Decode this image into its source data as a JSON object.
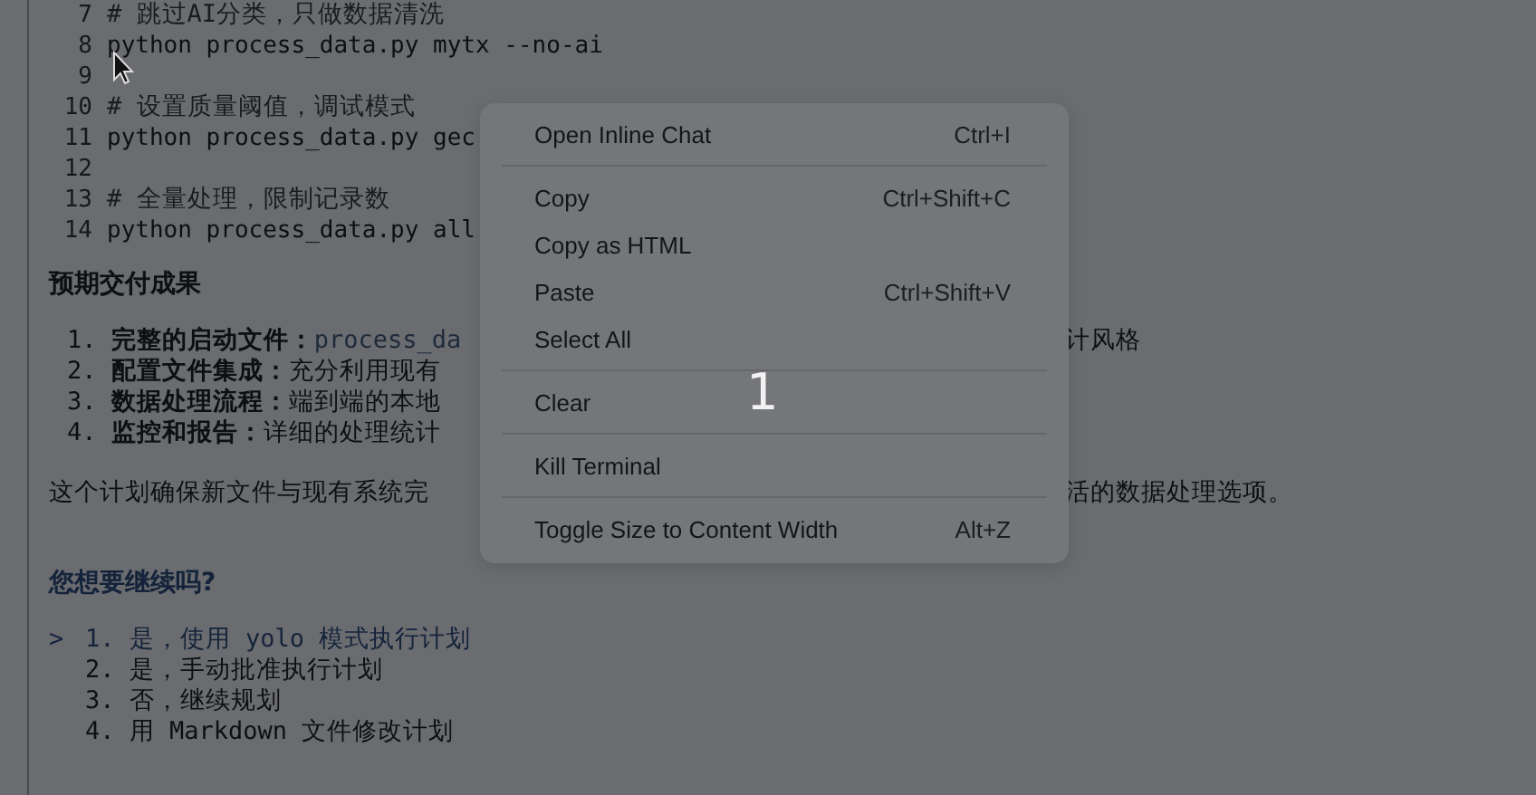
{
  "editor": {
    "code_lines": [
      {
        "number": "7",
        "text": "# 跳过AI分类，只做数据清洗",
        "kind": "comment"
      },
      {
        "number": "8",
        "text": "python process_data.py mytx --no-ai",
        "kind": "command"
      },
      {
        "number": "9",
        "kind": "blank"
      },
      {
        "number": "10",
        "text": "# 设置质量阈值，调试模式",
        "kind": "comment"
      },
      {
        "number": "11",
        "text": "python process_data.py gec",
        "kind": "command"
      },
      {
        "number": "12",
        "kind": "blank"
      },
      {
        "number": "13",
        "text": "# 全量处理，限制记录数",
        "kind": "comment"
      },
      {
        "number": "14",
        "text": "python process_data.py all",
        "kind": "command"
      }
    ],
    "heading": "预期交付成果",
    "deliverables": [
      {
        "marker": "1.",
        "title": "完整的启动文件：",
        "detail": "process_da",
        "kind": "code",
        "trailing": "计风格"
      },
      {
        "marker": "2.",
        "title": "配置文件集成：",
        "detail": "充分利用现有",
        "kind": "text"
      },
      {
        "marker": "3.",
        "title": "数据处理流程：",
        "detail": "端到端的本地",
        "kind": "text"
      },
      {
        "marker": "4.",
        "title": "监控和报告：",
        "detail": "详细的处理统计",
        "kind": "text"
      }
    ],
    "summary": {
      "text": "这个计划确保新文件与现有系统完",
      "trailing": "活的数据处理选项。"
    },
    "question": "您想要继续吗?",
    "option_pointer": ">",
    "options": [
      {
        "marker": "1.",
        "label": "是，使用 yolo 模式执行计划",
        "selected": true
      },
      {
        "marker": "2.",
        "label": "是，手动批准执行计划",
        "selected": false
      },
      {
        "marker": "3.",
        "label": "否，继续规划",
        "selected": false
      },
      {
        "marker": "4.",
        "label": "用 Markdown 文件修改计划",
        "selected": false
      }
    ]
  },
  "context_menu": {
    "groups": [
      [
        {
          "label": "Open Inline Chat",
          "shortcut": "Ctrl+I"
        }
      ],
      [
        {
          "label": "Copy",
          "shortcut": "Ctrl+Shift+C"
        },
        {
          "label": "Copy as HTML"
        },
        {
          "label": "Paste",
          "shortcut": "Ctrl+Shift+V"
        },
        {
          "label": "Select All"
        }
      ],
      [
        {
          "label": "Clear"
        }
      ],
      [
        {
          "label": "Kill Terminal"
        }
      ],
      [
        {
          "label": "Toggle Size to Content Width",
          "shortcut": "Alt+Z"
        }
      ]
    ]
  },
  "overlay_label": "1"
}
